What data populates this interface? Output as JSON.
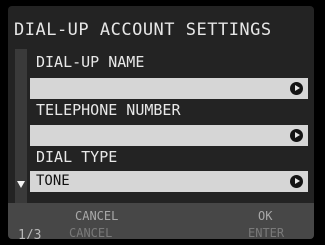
{
  "title": "DIAL-UP ACCOUNT SETTINGS",
  "fields": [
    {
      "label": "DIAL-UP NAME",
      "value": ""
    },
    {
      "label": "TELEPHONE NUMBER",
      "value": ""
    },
    {
      "label": "DIAL TYPE",
      "value": "TONE"
    }
  ],
  "footer": {
    "page": "1/3",
    "cancel_label": "CANCEL",
    "cancel_sub": "CANCEL",
    "ok_label": "OK",
    "ok_sub": "ENTER"
  },
  "icons": {
    "field_action": "arrow-right-circle-icon",
    "scroll_indicator": "triangle-down-icon"
  }
}
